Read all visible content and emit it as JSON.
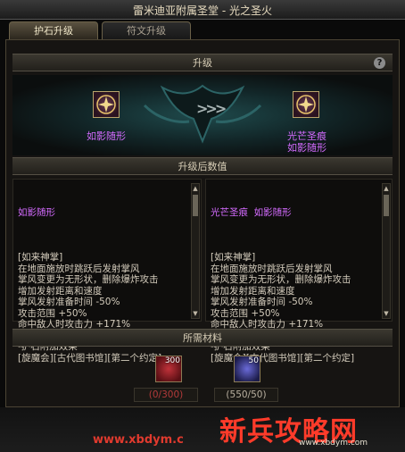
{
  "window": {
    "title": "雷米迪亚附属圣堂 - 光之圣火"
  },
  "tabs": [
    {
      "label": "护石升级",
      "active": true
    },
    {
      "label": "符文升级",
      "active": false
    }
  ],
  "upgrade": {
    "section_title": "升级",
    "help_label": "?",
    "from_item": {
      "name": "如影随形",
      "icon": "talisman-icon"
    },
    "arrow_symbol": ">>>",
    "to_item": {
      "name_line1": "光芒圣痕",
      "name_line2": "如影随形",
      "icon": "talisman-icon"
    }
  },
  "stats": {
    "section_title": "升级后数值",
    "left": {
      "title": "如影随形",
      "lines": [
        "",
        "[如来神掌]",
        "在地面施放时跳跃后发射掌风",
        "掌风变更为无形状，删除爆炸攻击",
        "增加发射距离和速度",
        "掌风发射准备时间 -50%",
        "攻击范围 +50%",
        "命中敌人时攻击力 +171%",
        "",
        "-护石附加效果",
        "[旋魔会][古代图书馆][第二个约定]"
      ]
    },
    "right": {
      "title": "光芒圣痕  如影随形",
      "lines": [
        "",
        "[如来神掌]",
        "在地面施放时跳跃后发射掌风",
        "掌风变更为无形状，删除爆炸攻击",
        "增加发射距离和速度",
        "掌风发射准备时间 -50%",
        "攻击范围 +50%",
        "命中敌人时攻击力 +171%",
        "",
        "-护石附加效果",
        "[旋魔会][古代图书馆][第二个约定]"
      ]
    }
  },
  "materials": {
    "section_title": "所需材料",
    "items": [
      {
        "count": "300",
        "requirement": "(0/300)",
        "icon": "red-crystal-icon"
      },
      {
        "count": "50",
        "requirement": "(550/50)",
        "icon": "sword-shard-icon"
      }
    ]
  },
  "watermark": {
    "url_left": "www.xbdym.c",
    "logo_text": "新兵攻略网",
    "url_right": "www.xbdym.com"
  },
  "colors": {
    "purple_item": "#d46bff",
    "red_requirement": "#b33a3a",
    "teal_glow": "#1f4a4c"
  }
}
